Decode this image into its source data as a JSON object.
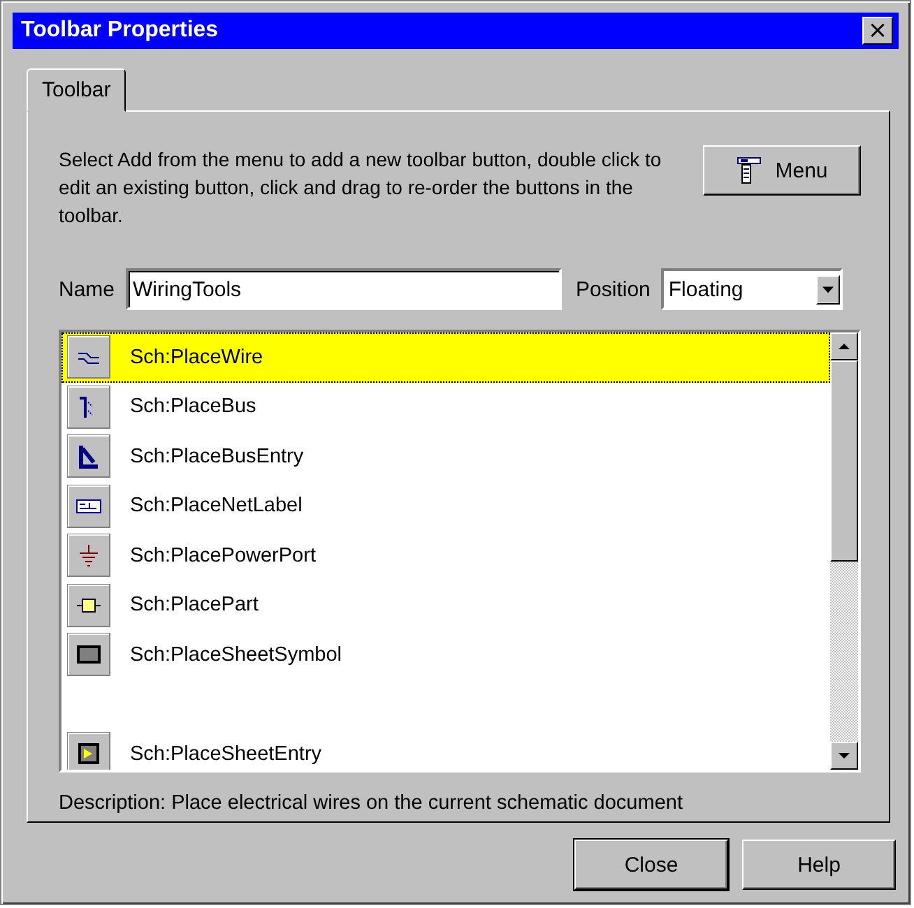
{
  "window": {
    "title": "Toolbar Properties",
    "close_glyph": "×"
  },
  "tabs": [
    {
      "label": "Toolbar",
      "selected": true
    }
  ],
  "instructions": "Select Add from the menu to add a new toolbar button, double click to edit an existing button, click and drag to re-order the buttons in the toolbar.",
  "menu_button": "Menu",
  "name_field": {
    "label": "Name",
    "value": "WiringTools"
  },
  "position_field": {
    "label": "Position",
    "value": "Floating"
  },
  "commands": [
    {
      "kind": "command",
      "label": "Sch:PlaceWire",
      "selected": true
    },
    {
      "kind": "command",
      "label": "Sch:PlaceBus",
      "selected": false
    },
    {
      "kind": "command",
      "label": "Sch:PlaceBusEntry",
      "selected": false
    },
    {
      "kind": "command",
      "label": "Sch:PlaceNetLabel",
      "selected": false
    },
    {
      "kind": "command",
      "label": "Sch:PlacePowerPort",
      "selected": false
    },
    {
      "kind": "command",
      "label": "Sch:PlacePart",
      "selected": false
    },
    {
      "kind": "command",
      "label": "Sch:PlaceSheetSymbol",
      "selected": false
    },
    {
      "kind": "separator"
    },
    {
      "kind": "command",
      "label": "Sch:PlaceSheetEntry",
      "selected": false
    }
  ],
  "description": "Description: Place electrical wires on the current schematic document",
  "buttons": [
    {
      "label": "Close",
      "default": true
    },
    {
      "label": "Help",
      "default": false
    }
  ]
}
